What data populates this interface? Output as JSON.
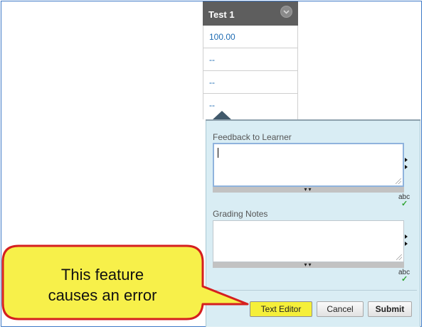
{
  "grade_column": {
    "header_title": "Test 1",
    "menu_icon": "chevron-down-icon",
    "cells": [
      "100.00",
      "--",
      "--",
      "--"
    ]
  },
  "popup": {
    "feedback_label": "Feedback to Learner",
    "feedback_value": "",
    "notes_label": "Grading Notes",
    "notes_value": "",
    "spellcheck_text": "abc",
    "toggle_icon": "expand-icon"
  },
  "buttons": {
    "text_editor": "Text Editor",
    "cancel": "Cancel",
    "submit": "Submit"
  },
  "callout": {
    "line1": "This feature",
    "line2": "causes an error"
  },
  "colors": {
    "header_bg": "#5e5e5e",
    "popup_bg": "#d9edf4",
    "callout_fill": "#f7f04a",
    "callout_stroke": "#d51f1f",
    "highlight_button": "#f5ef3a",
    "link_blue": "#1f6cb3"
  }
}
